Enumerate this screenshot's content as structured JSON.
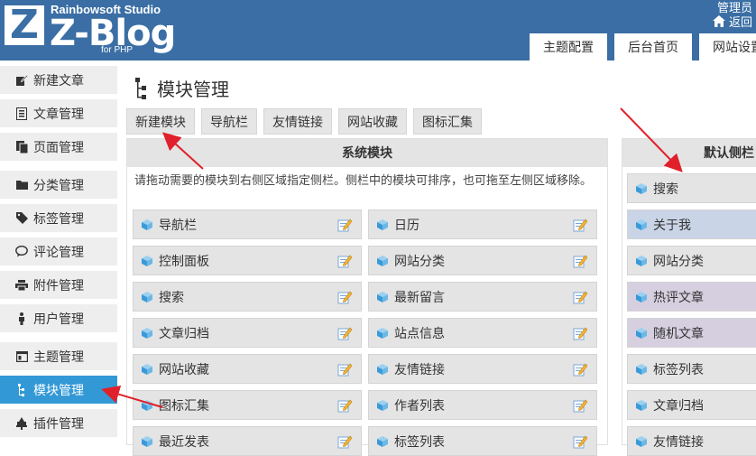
{
  "header": {
    "studio": "Rainbowsoft Studio",
    "logo_letter": "Z",
    "brand": "Z-Blog",
    "brand_sub": "for PHP",
    "user_link": "管理员",
    "back_link": "返回",
    "tabs": [
      {
        "label": "主题配置"
      },
      {
        "label": "后台首页"
      },
      {
        "label": "网站设置"
      }
    ]
  },
  "sidebar": {
    "items": [
      {
        "label": "新建文章",
        "icon": "pencil-icon"
      },
      {
        "label": "文章管理",
        "icon": "article-icon"
      },
      {
        "label": "页面管理",
        "icon": "pages-icon"
      },
      {
        "label": "分类管理",
        "icon": "folder-icon"
      },
      {
        "label": "标签管理",
        "icon": "tag-icon"
      },
      {
        "label": "评论管理",
        "icon": "comment-icon"
      },
      {
        "label": "附件管理",
        "icon": "attachment-icon"
      },
      {
        "label": "用户管理",
        "icon": "user-icon"
      },
      {
        "label": "主题管理",
        "icon": "theme-icon"
      },
      {
        "label": "模块管理",
        "icon": "module-icon",
        "active": true
      },
      {
        "label": "插件管理",
        "icon": "plugin-icon"
      }
    ]
  },
  "main": {
    "title": "模块管理",
    "sub_tabs": [
      {
        "label": "新建模块"
      },
      {
        "label": "导航栏"
      },
      {
        "label": "友情链接"
      },
      {
        "label": "网站收藏"
      },
      {
        "label": "图标汇集"
      }
    ],
    "system_panel": {
      "title": "系统模块",
      "description": "请拖动需要的模块到右侧区域指定侧栏。侧栏中的模块可排序，也可拖至左侧区域移除。",
      "modules_left": [
        "导航栏",
        "控制面板",
        "搜索",
        "文章归档",
        "网站收藏",
        "图标汇集",
        "最近发表"
      ],
      "modules_right": [
        "日历",
        "网站分类",
        "最新留言",
        "站点信息",
        "友情链接",
        "作者列表",
        "标签列表"
      ]
    },
    "sidebar_panel": {
      "title": "默认侧栏",
      "modules": [
        "搜索",
        "关于我",
        "网站分类",
        "热评文章",
        "随机文章",
        "标签列表",
        "文章归档",
        "友情链接"
      ],
      "colors": [
        "#e4e4e4",
        "#c9d4e6",
        "#e4e4e4",
        "#d6cfe0",
        "#d6cfe0",
        "#e4e4e4",
        "#e4e4e4",
        "#e4e4e4"
      ]
    }
  },
  "colors": {
    "header": "#3a6ea5",
    "active": "#3399d6",
    "arrow": "#e0202a"
  }
}
